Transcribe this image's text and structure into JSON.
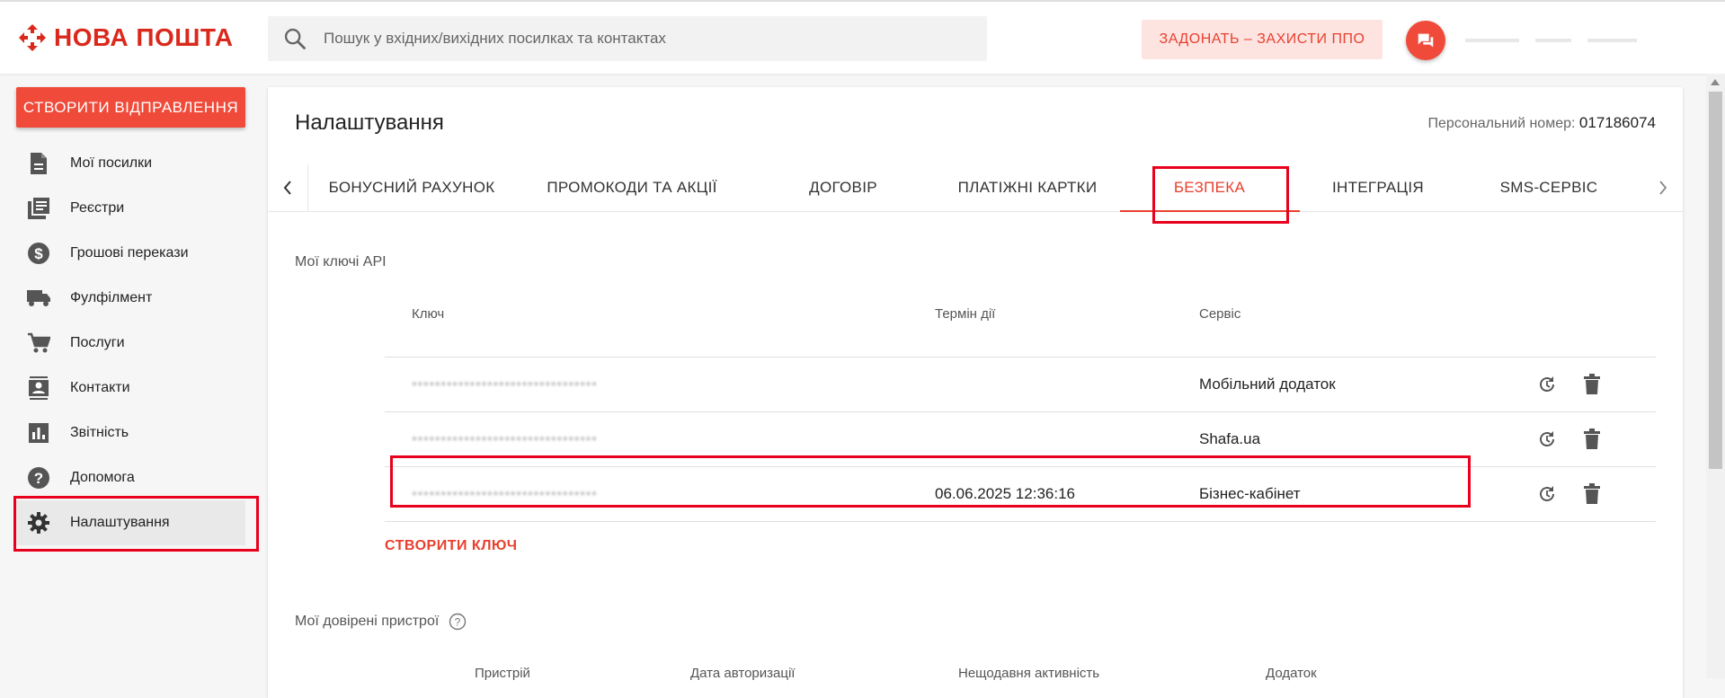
{
  "header": {
    "brand": "НОВА ПОШТА",
    "search_placeholder": "Пошук у вхідних/вихідних посилках та контактах",
    "promo_label": "ЗАДОНАТЬ – ЗАХИСТИ ППО",
    "accent": "#da291c"
  },
  "sidebar": {
    "create_label": "СТВОРИТИ ВІДПРАВЛЕННЯ",
    "items": [
      {
        "label": "Мої посилки",
        "icon": "document-icon"
      },
      {
        "label": "Реєстри",
        "icon": "registry-icon"
      },
      {
        "label": "Грошові перекази",
        "icon": "dollar-icon"
      },
      {
        "label": "Фулфілмент",
        "icon": "truck-icon"
      },
      {
        "label": "Послуги",
        "icon": "cart-icon"
      },
      {
        "label": "Контакти",
        "icon": "contacts-icon"
      },
      {
        "label": "Звітність",
        "icon": "chart-icon"
      },
      {
        "label": "Допомога",
        "icon": "help-icon"
      },
      {
        "label": "Налаштування",
        "icon": "gear-icon",
        "active": true
      }
    ]
  },
  "main": {
    "title": "Налаштування",
    "personal_label": "Персональний номер:",
    "personal_number": "017186074",
    "tabs": [
      {
        "label": "БОНУСНИЙ РАХУНОК"
      },
      {
        "label": "ПРОМОКОДИ ТА АКЦІЇ"
      },
      {
        "label": "ДОГОВІР"
      },
      {
        "label": "ПЛАТІЖНІ КАРТКИ"
      },
      {
        "label": "БЕЗПЕКА",
        "active": true
      },
      {
        "label": "ІНТЕГРАЦІЯ"
      },
      {
        "label": "SMS-СЕРВІС"
      }
    ],
    "api_section_title": "Мої ключі API",
    "api_table": {
      "columns": [
        "Ключ",
        "Термін дії",
        "Сервіс"
      ],
      "rows": [
        {
          "key": "••••••••••••••••••••••••••••••••",
          "expiry": "",
          "service": "Мобільний додаток"
        },
        {
          "key": "••••••••••••••••••••••••••••••••",
          "expiry": "",
          "service": "Shafa.ua"
        },
        {
          "key": "••••••••••••••••••••••••••••••••",
          "expiry": "06.06.2025 12:36:16",
          "service": "Бізнес-кабінет"
        }
      ]
    },
    "create_key_label": "СТВОРИТИ КЛЮЧ",
    "devices_section_title": "Мої довірені пристрої",
    "devices_columns": [
      "Пристрій",
      "Дата авторизації",
      "Нещодавня активність",
      "Додаток"
    ]
  }
}
